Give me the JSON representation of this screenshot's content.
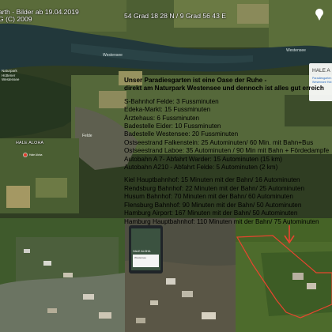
{
  "header": {
    "left_text": "arth - Bilder ab 19.04.2019\nG (C) 2009",
    "coordinates": "54 Grad 18 28 N / 9 Grad 56 43 E"
  },
  "map_labels": {
    "lake": "Westensee",
    "westensee": "Westensee",
    "park": "Naturpark\nHüttener\nWestensee",
    "felde": "Felde",
    "hale_aloha": "HALE ALOHA",
    "pin_caption": "Hale Aloha"
  },
  "panel_top_right": {
    "title": "HALE A",
    "subtitle": "Paradiesgarten",
    "subtitle2": "Westensee Hot"
  },
  "info": {
    "headline1": "Unser Paradiesgarten ist eine Oase der Ruhe -",
    "headline2": "direkt am Naturpark Westensee und dennoch ist alles gut erreich",
    "distances": [
      "S-Bahnhof Felde: 3 Fussminuten",
      "Edeka-Markt: 15 Fussminuten",
      "Ärztehaus: 6 Fussminuten",
      "Badestelle Eider: 10 Fussminuten",
      "Badestelle Westensee: 20 Fussminuten",
      "Ostseestrand Falkenstein: 25 Autominuten/ 60 Min. mit Bahn+Bus",
      "Ostseestrand Laboe: 35 Autominuten / 90 Min mit Bahn + Fördedampfe",
      "Autobahn A 7- Abfahrt Warder: 15 Autominuten (15 km)",
      "Autobahn A210 - Abfahrt Felde: 5 Autominuten (2 km)"
    ],
    "stations": [
      "Kiel Hauptbahnhof: 15 Minuten mit der Bahn/ 16 Autominuten",
      "Rendsburg Bahnhof: 22 Minuten mit der Bahn/ 25 Autominuten",
      "Husum Bahnhof: 70 Minuten mit der Bahn/ 60 Autominuten",
      "Flensburg Bahnhof: 90 Minuten mit der Bahn/ 50 Autominuten",
      "Hamburg Airport: 167 Minuten mit der Bahn/ 50 Autominuten",
      "Hamburg Hauptbahnhof: 110 Minuten mit der Bahn/ 75 Autominuten"
    ]
  },
  "phone": {
    "title": "HALE ALOHA",
    "card_text": "Westensee"
  },
  "colors": {
    "property_outline": "#e8452f",
    "arrow": "#e8452f"
  },
  "icons": [
    "location-pin-icon",
    "arrow-down-icon"
  ]
}
